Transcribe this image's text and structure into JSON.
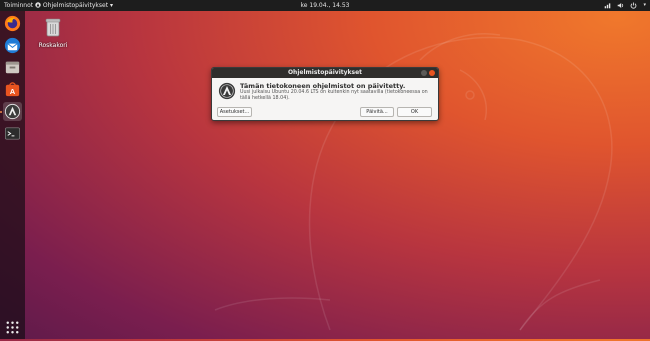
{
  "topbar": {
    "activities": "Toiminnot",
    "app_menu": "Ohjelmistopäivitykset",
    "clock": "ke 19.04., 14.53"
  },
  "desktop": {
    "trash_label": "Roskakori"
  },
  "dialog": {
    "title": "Ohjelmistopäivitykset",
    "heading": "Tämän tietokoneen ohjelmistot on päivitetty.",
    "body": "Uusi julkaisu Ubuntu 20.04.6 LTS on kuitenkin nyt saatavilla (tietokoneessa on tällä hetkellä 18.04).",
    "settings_button": "Asetukset...",
    "update_button": "Päivitä...",
    "ok_button": "OK"
  },
  "colors": {
    "topbar": "#1d1d1d",
    "accent": "#e95420",
    "dialog_bg": "#f6f5f4"
  },
  "icons": {
    "dock": [
      "firefox-icon",
      "thunderbird-icon",
      "files-icon",
      "software-center-icon",
      "software-updater-icon",
      "terminal-icon",
      "show-apps-icon"
    ],
    "tray": [
      "network-icon",
      "volume-icon",
      "power-icon",
      "menu-arrow-icon"
    ]
  }
}
